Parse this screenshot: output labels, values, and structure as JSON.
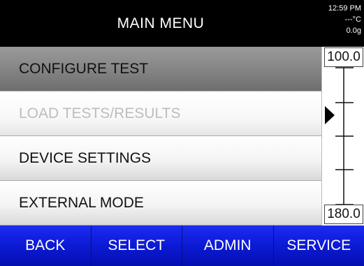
{
  "header": {
    "title": "MAIN MENU",
    "time": "12:59 PM",
    "temperature": "---°C",
    "weight": "0.0g"
  },
  "menu": {
    "items": [
      {
        "label": "CONFIGURE TEST",
        "state": "selected"
      },
      {
        "label": "LOAD TESTS/RESULTS",
        "state": "disabled"
      },
      {
        "label": "DEVICE SETTINGS",
        "state": "normal"
      },
      {
        "label": "EXTERNAL MODE",
        "state": "normal"
      }
    ]
  },
  "gauge": {
    "top_label": "100.0",
    "bottom_label": "180.0"
  },
  "footer": {
    "back_label": "BACK",
    "select_label": "SELECT",
    "admin_label": "ADMIN",
    "service_label": "SERVICE"
  },
  "colors": {
    "header_bg": "#000000",
    "footer_bg": "#0c1ad4",
    "selected_bg": "#838383"
  }
}
